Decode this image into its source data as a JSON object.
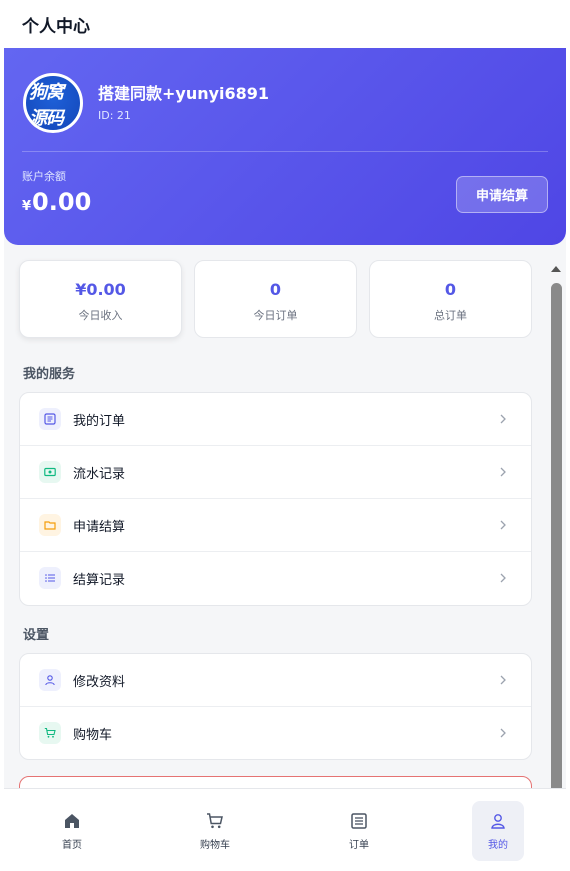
{
  "header": {
    "title": "个人中心"
  },
  "profile": {
    "avatar_text_line1": "狗窝",
    "avatar_text_line2": "源码",
    "name": "搭建同款+yunyi6891",
    "id_text": "ID: 21",
    "balance_label": "账户余额",
    "currency_symbol": "¥",
    "balance_value": "0.00",
    "settle_button": "申请结算"
  },
  "stats": [
    {
      "value": "¥0.00",
      "label": "今日收入"
    },
    {
      "value": "0",
      "label": "今日订单"
    },
    {
      "value": "0",
      "label": "总订单"
    }
  ],
  "services": {
    "title": "我的服务",
    "items": [
      {
        "label": "我的订单",
        "icon": "order-list-icon",
        "color": "#5458e6",
        "bg": "#eef0fd"
      },
      {
        "label": "流水记录",
        "icon": "money-icon",
        "color": "#10b981",
        "bg": "#e7f8f1"
      },
      {
        "label": "申请结算",
        "icon": "wallet-icon",
        "color": "#f59e0b",
        "bg": "#fff4e2"
      },
      {
        "label": "结算记录",
        "icon": "list-icon",
        "color": "#5458e6",
        "bg": "#eef0fd"
      }
    ]
  },
  "settings": {
    "title": "设置",
    "items": [
      {
        "label": "修改资料",
        "icon": "user-icon",
        "color": "#5458e6",
        "bg": "#eef0fd"
      },
      {
        "label": "购物车",
        "icon": "cart-icon",
        "color": "#10b981",
        "bg": "#e7f8f1"
      }
    ]
  },
  "bottom_nav": [
    {
      "label": "首页",
      "icon": "home-icon"
    },
    {
      "label": "购物车",
      "icon": "cart-icon"
    },
    {
      "label": "订单",
      "icon": "order-icon"
    },
    {
      "label": "我的",
      "icon": "user-icon",
      "active": true
    }
  ],
  "colors": {
    "accent": "#5458e6",
    "hero_gradient_start": "#6366f1",
    "hero_gradient_end": "#4f46e5",
    "danger_border": "#e57373"
  }
}
